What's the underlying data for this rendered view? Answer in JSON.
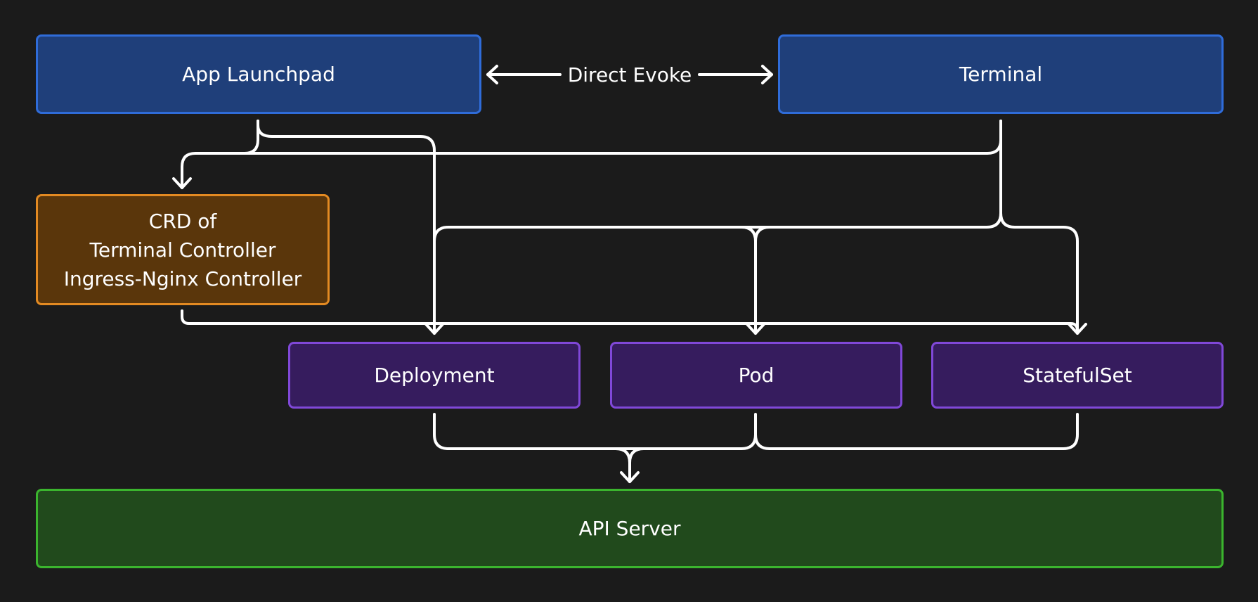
{
  "diagram": {
    "nodes": {
      "app_launchpad": {
        "label": "App Launchpad",
        "color": "#1f3f7a"
      },
      "terminal": {
        "label": "Terminal",
        "color": "#1f3f7a"
      },
      "crd": {
        "lines": [
          "CRD of",
          "Terminal Controller",
          "Ingress-Nginx Controller"
        ],
        "color": "#5a360b"
      },
      "deployment": {
        "label": "Deployment",
        "color": "#361c5e"
      },
      "pod": {
        "label": "Pod",
        "color": "#361c5e"
      },
      "statefulset": {
        "label": "StatefulSet",
        "color": "#361c5e"
      },
      "api_server": {
        "label": "API Server",
        "color": "#214a1c"
      }
    },
    "edges": {
      "direct_evoke": {
        "label": "Direct Evoke",
        "from": "App Launchpad",
        "to": "Terminal",
        "bidirectional": true
      }
    },
    "colors": {
      "background": "#1b1b1b",
      "connector": "#ffffff",
      "blue_border": "#2f6cd9",
      "orange_border": "#e38a22",
      "purple_border": "#8048d8",
      "green_border": "#3bb52e"
    }
  }
}
